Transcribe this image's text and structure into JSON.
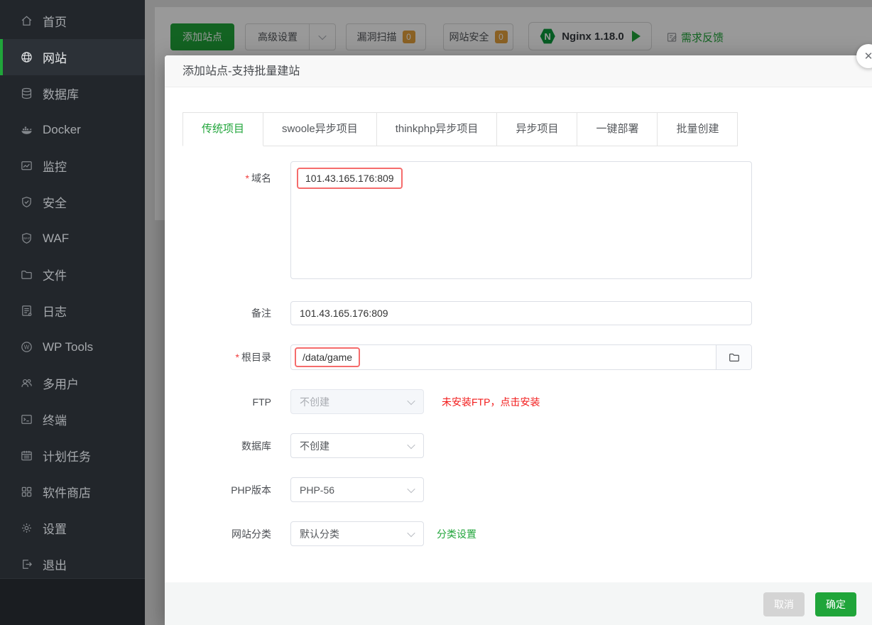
{
  "colors": {
    "accent_green": "#20a53a",
    "badge_orange": "#e6a23c",
    "danger_red": "#f21a1a",
    "validation_outline": "#f56c6c",
    "sidebar_bg": "#22262b"
  },
  "sidebar": {
    "items": [
      {
        "label": "首页",
        "icon": "home-icon",
        "active": false
      },
      {
        "label": "网站",
        "icon": "globe-icon",
        "active": true
      },
      {
        "label": "数据库",
        "icon": "database-icon",
        "active": false
      },
      {
        "label": "Docker",
        "icon": "docker-icon",
        "active": false
      },
      {
        "label": "监控",
        "icon": "monitor-icon",
        "active": false
      },
      {
        "label": "安全",
        "icon": "shield-check-icon",
        "active": false
      },
      {
        "label": "WAF",
        "icon": "waf-shield-icon",
        "active": false
      },
      {
        "label": "文件",
        "icon": "folder-icon",
        "active": false
      },
      {
        "label": "日志",
        "icon": "log-file-icon",
        "active": false
      },
      {
        "label": "WP Tools",
        "icon": "wordpress-icon",
        "active": false
      },
      {
        "label": "多用户",
        "icon": "users-icon",
        "active": false
      },
      {
        "label": "终端",
        "icon": "terminal-icon",
        "active": false
      },
      {
        "label": "计划任务",
        "icon": "calendar-icon",
        "active": false
      },
      {
        "label": "软件商店",
        "icon": "appstore-grid-icon",
        "active": false
      },
      {
        "label": "设置",
        "icon": "gear-icon",
        "active": false
      },
      {
        "label": "退出",
        "icon": "logout-icon",
        "active": false
      }
    ]
  },
  "toolbar": {
    "add_site_label": "添加站点",
    "advanced_settings_label": "高级设置",
    "vuln_scan_label": "漏洞扫描",
    "vuln_scan_count": "0",
    "site_security_label": "网站安全",
    "site_security_count": "0",
    "webserver_logo_letter": "N",
    "webserver_label": "Nginx 1.18.0",
    "feedback_label": "需求反馈"
  },
  "modal": {
    "title": "添加站点-支持批量建站",
    "close_glyph": "✕",
    "tabs": [
      {
        "label": "传统项目",
        "active": true
      },
      {
        "label": "swoole异步项目",
        "active": false
      },
      {
        "label": "thinkphp异步项目",
        "active": false
      },
      {
        "label": "异步项目",
        "active": false
      },
      {
        "label": "一键部署",
        "active": false
      },
      {
        "label": "批量创建",
        "active": false
      }
    ],
    "form": {
      "required_marker": "*",
      "domain_label": "域名",
      "domain_value": "101.43.165.176:809",
      "remark_label": "备注",
      "remark_value": "101.43.165.176:809",
      "root_label": "根目录",
      "root_value": "/data/game",
      "ftp_label": "FTP",
      "ftp_value": "不创建",
      "ftp_warning": "未安装FTP，点击安装",
      "database_label": "数据库",
      "database_value": "不创建",
      "php_label": "PHP版本",
      "php_value": "PHP-56",
      "category_label": "网站分类",
      "category_value": "默认分类",
      "category_link": "分类设置"
    },
    "footer": {
      "cancel_label": "取消",
      "confirm_label": "确定"
    }
  }
}
